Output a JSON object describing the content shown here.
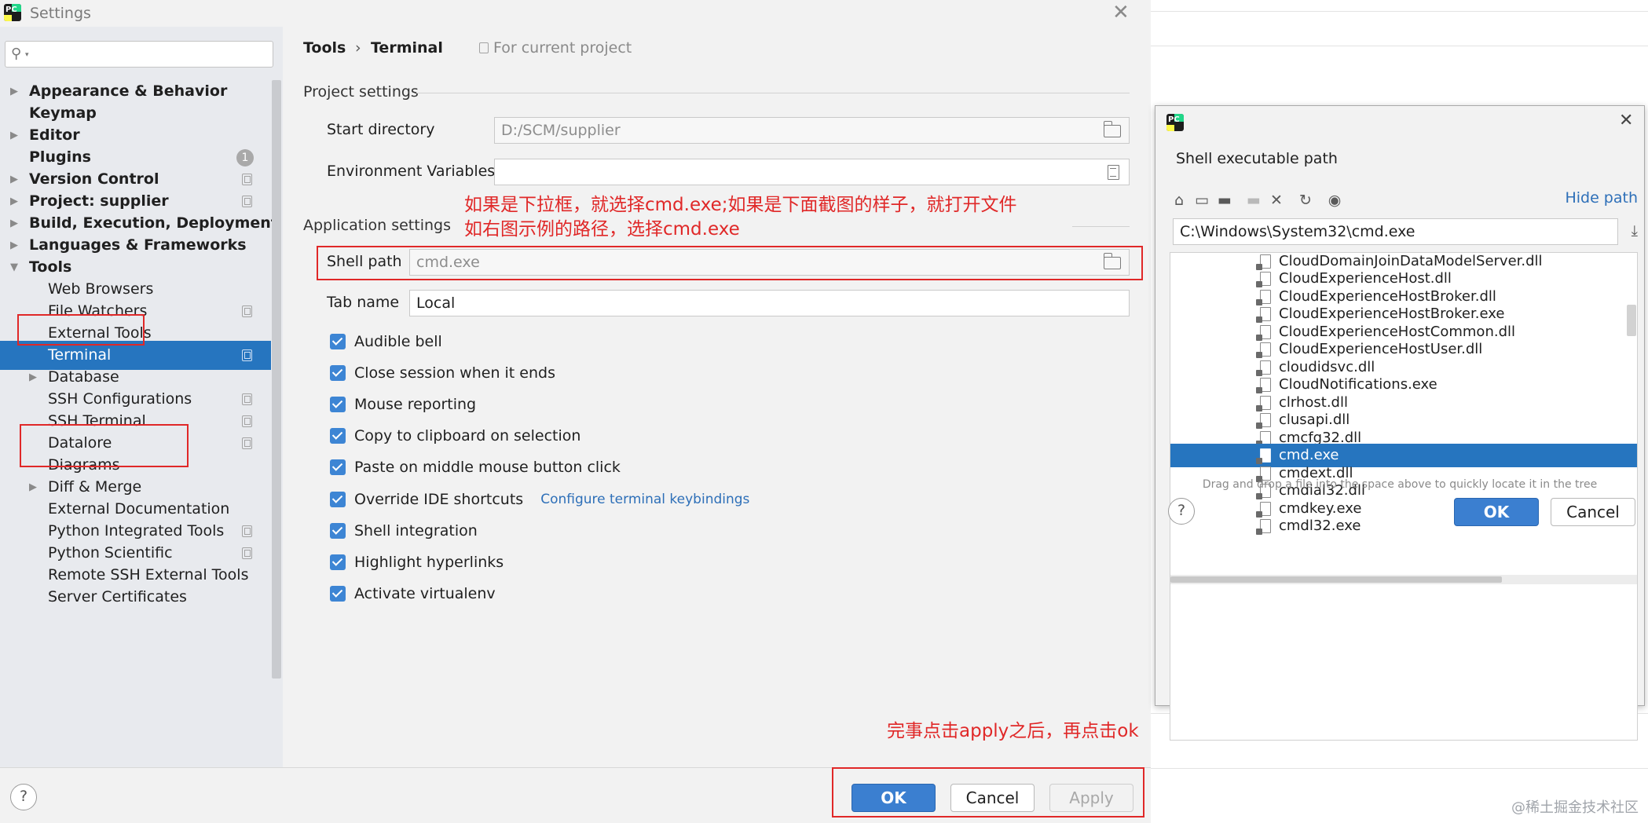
{
  "settings": {
    "title": "Settings",
    "app_icon_text": "PC",
    "search": {
      "value": "",
      "placeholder": ""
    },
    "sidebar_items": [
      {
        "label": "Appearance & Behavior"
      },
      {
        "label": "Keymap"
      },
      {
        "label": "Editor"
      },
      {
        "label": "Plugins",
        "badge": "1"
      },
      {
        "label": "Version Control"
      },
      {
        "label": "Project: supplier"
      },
      {
        "label": "Build, Execution, Deployment"
      },
      {
        "label": "Languages & Frameworks"
      },
      {
        "label": "Tools"
      },
      {
        "label": "Web Browsers"
      },
      {
        "label": "File Watchers"
      },
      {
        "label": "External Tools"
      },
      {
        "label": "Terminal"
      },
      {
        "label": "Database"
      },
      {
        "label": "SSH Configurations"
      },
      {
        "label": "SSH Terminal"
      },
      {
        "label": "Datalore"
      },
      {
        "label": "Diagrams"
      },
      {
        "label": "Diff & Merge"
      },
      {
        "label": "External Documentation"
      },
      {
        "label": "Python Integrated Tools"
      },
      {
        "label": "Python Scientific"
      },
      {
        "label": "Remote SSH External Tools"
      },
      {
        "label": "Server Certificates"
      }
    ],
    "breadcrumb": {
      "parent": "Tools",
      "separator": "›",
      "current": "Terminal",
      "scope": "For current project"
    },
    "project_settings": {
      "title": "Project settings",
      "start_directory_label": "Start directory",
      "start_directory_value": "D:/SCM/supplier",
      "env_vars_label": "Environment Variables",
      "env_vars_value": ""
    },
    "application_settings": {
      "title": "Application settings",
      "shell_path_label": "Shell path",
      "shell_path_value": "cmd.exe",
      "tab_name_label": "Tab name",
      "tab_name_value": "Local"
    },
    "checkboxes": [
      {
        "label": "Audible bell",
        "checked": true
      },
      {
        "label": "Close session when it ends",
        "checked": true
      },
      {
        "label": "Mouse reporting",
        "checked": true
      },
      {
        "label": "Copy to clipboard on selection",
        "checked": true
      },
      {
        "label": "Paste on middle mouse button click",
        "checked": true
      },
      {
        "label": "Override IDE shortcuts",
        "checked": true,
        "link": "Configure terminal keybindings"
      },
      {
        "label": "Shell integration",
        "checked": true
      },
      {
        "label": "Highlight hyperlinks",
        "checked": true
      },
      {
        "label": "Activate virtualenv",
        "checked": true
      }
    ],
    "buttons": {
      "help": "?",
      "ok": "OK",
      "cancel": "Cancel",
      "apply": "Apply"
    }
  },
  "annotations": {
    "note_line1": "如果是下拉框，就选择cmd.exe;如果是下面截图的样子，就打开文件",
    "note_line2": "如右图示例的路径，选择cmd.exe",
    "note_apply": "完事点击apply之后，再点击ok",
    "color": "#e02828"
  },
  "dialog": {
    "title": "Shell executable path",
    "close": "✕",
    "hide_path_label": "Hide path",
    "toolbar_icons": [
      "home-icon",
      "desktop-icon",
      "project-folder-icon",
      "new-folder-icon",
      "delete-icon",
      "refresh-icon",
      "show-hidden-icon"
    ],
    "path_value": "C:\\Windows\\System32\\cmd.exe",
    "files": [
      {
        "name": "CloudDomainJoinDataModelServer.dll"
      },
      {
        "name": "CloudExperienceHost.dll"
      },
      {
        "name": "CloudExperienceHostBroker.dll"
      },
      {
        "name": "CloudExperienceHostBroker.exe"
      },
      {
        "name": "CloudExperienceHostCommon.dll"
      },
      {
        "name": "CloudExperienceHostUser.dll"
      },
      {
        "name": "cloudidsvc.dll"
      },
      {
        "name": "CloudNotifications.exe"
      },
      {
        "name": "clrhost.dll"
      },
      {
        "name": "clusapi.dll"
      },
      {
        "name": "cmcfg32.dll"
      },
      {
        "name": "cmd.exe",
        "selected": true
      },
      {
        "name": "cmdext.dll"
      },
      {
        "name": "cmdial32.dll"
      },
      {
        "name": "cmdkey.exe"
      },
      {
        "name": "cmdl32.exe"
      }
    ],
    "hint": "Drag and drop a file into the space above to quickly locate it in the tree",
    "buttons": {
      "help": "?",
      "ok": "OK",
      "cancel": "Cancel"
    }
  },
  "watermark": "@稀土掘金技术社区",
  "colors": {
    "accent": "#2675bf",
    "checkbox": "#3d85d4",
    "link": "#2d6fb8"
  }
}
